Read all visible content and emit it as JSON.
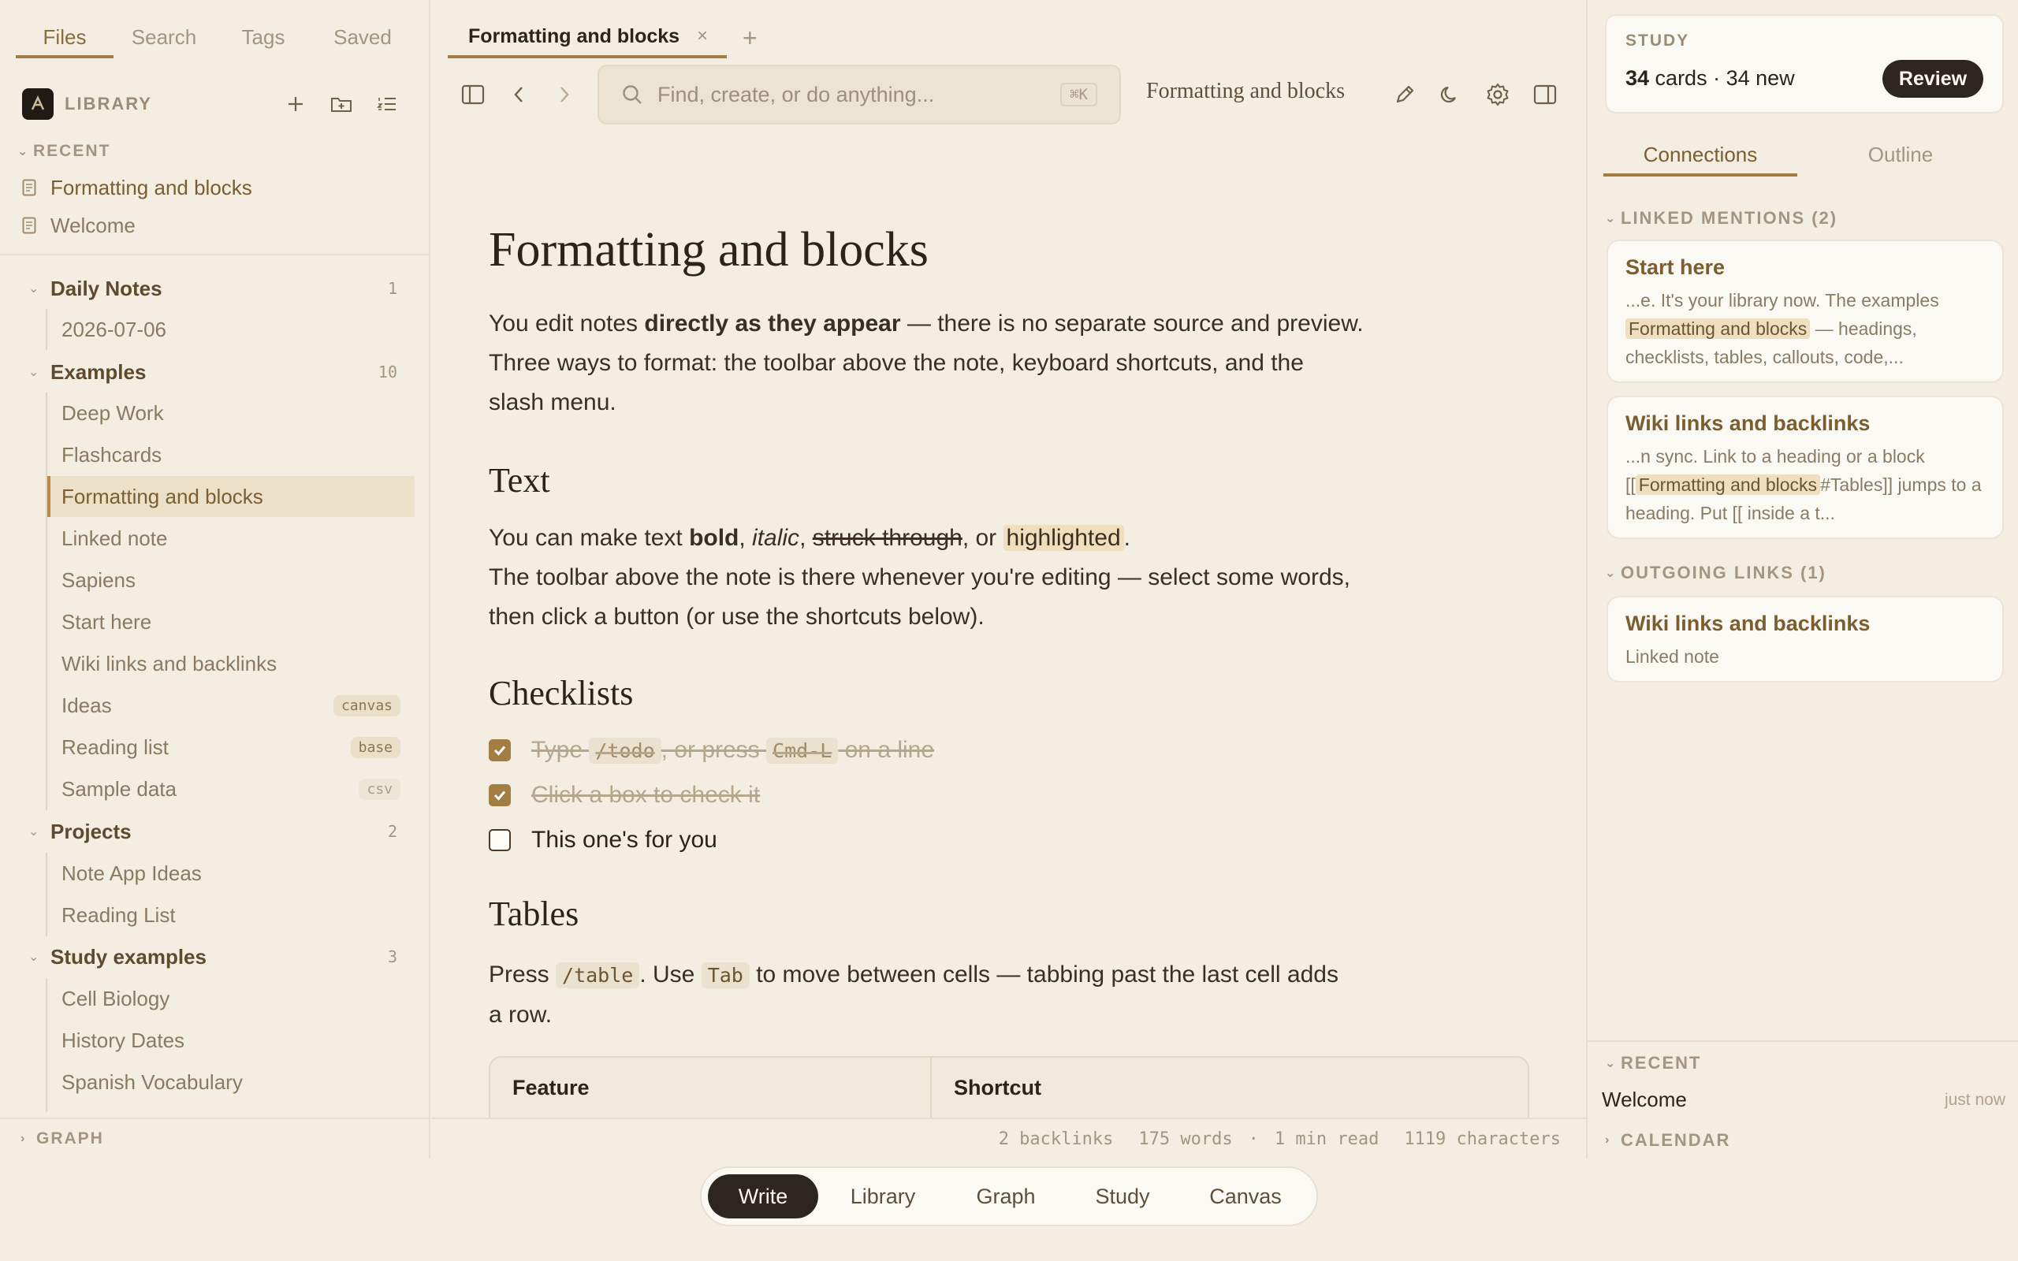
{
  "left_tabs": [
    {
      "label": "Files",
      "active": true
    },
    {
      "label": "Search",
      "active": false
    },
    {
      "label": "Tags",
      "active": false
    },
    {
      "label": "Saved",
      "active": false
    }
  ],
  "library": {
    "title": "LIBRARY"
  },
  "recent": {
    "title": "RECENT",
    "items": [
      "Formatting and blocks",
      "Welcome"
    ]
  },
  "tree": {
    "daily_notes": {
      "name": "Daily Notes",
      "count": "1",
      "children": [
        "2026-07-06"
      ]
    },
    "examples": {
      "name": "Examples",
      "count": "10",
      "children": [
        {
          "name": "Deep Work",
          "badge": ""
        },
        {
          "name": "Flashcards",
          "badge": ""
        },
        {
          "name": "Formatting and blocks",
          "badge": ""
        },
        {
          "name": "Linked note",
          "badge": ""
        },
        {
          "name": "Sapiens",
          "badge": ""
        },
        {
          "name": "Start here",
          "badge": ""
        },
        {
          "name": "Wiki links and backlinks",
          "badge": ""
        },
        {
          "name": "Ideas",
          "badge": "canvas"
        },
        {
          "name": "Reading list",
          "badge": "base"
        },
        {
          "name": "Sample data",
          "badge": "csv"
        }
      ]
    },
    "projects": {
      "name": "Projects",
      "count": "2",
      "children": [
        "Note App Ideas",
        "Reading List"
      ]
    },
    "study": {
      "name": "Study examples",
      "count": "3",
      "children": [
        "Cell Biology",
        "History Dates",
        "Spanish Vocabulary"
      ]
    }
  },
  "graph_footer": "GRAPH",
  "doc_tab": {
    "label": "Formatting and blocks",
    "close": "×",
    "new": "+"
  },
  "search": {
    "placeholder": "Find, create, or do anything...",
    "shortcut": "⌘K"
  },
  "toolbar_title": "Formatting and blocks",
  "note": {
    "title": "Formatting and blocks",
    "intro": {
      "a": "You edit notes ",
      "b": "directly as they appear",
      "c": " — there is no separate source and preview. Three ways to format: the toolbar above the note, keyboard shortcuts, and the slash menu."
    },
    "text_heading": "Text",
    "text_line1": {
      "a": "You can make text ",
      "bold": "bold",
      "c": ", ",
      "italic": "italic",
      "d": ", ",
      "strike": "struck through",
      "e": ", or ",
      "hl": "highlighted",
      "f": "."
    },
    "text_line2": "The toolbar above the note is there whenever you're editing — select some words, then click a button (or use the shortcuts below).",
    "checklists_heading": "Checklists",
    "check1": {
      "a": "Type ",
      "code1": "/todo",
      "b": ", or press ",
      "code2": "Cmd-L",
      "c": " on a line"
    },
    "check2": "Click a box to check it",
    "check3": "This one's for you",
    "tables_heading": "Tables",
    "tables_para": {
      "a": "Press ",
      "code1": "/table",
      "b": ". Use ",
      "code2": "Tab",
      "c": " to move between cells — tabbing past the last cell adds a row."
    },
    "table_headers": [
      "Feature",
      "Shortcut"
    ]
  },
  "status": {
    "backlinks": "2 backlinks",
    "words": "175 words",
    "dot": "·",
    "read": "1 min read",
    "chars": "1119 characters"
  },
  "study_card": {
    "label": "STUDY",
    "count_bold": "34",
    "count_rest": " cards · 34 new",
    "button": "Review"
  },
  "right_tabs": [
    {
      "label": "Connections",
      "active": true
    },
    {
      "label": "Outline",
      "active": false
    }
  ],
  "linked_mentions": {
    "title": "LINKED MENTIONS (2)",
    "items": [
      {
        "title": "Start here",
        "pre": "...e. It's your library now. The examples ",
        "mark": "Formatting and blocks",
        "post": " — headings, checklists, tables, callouts, code,..."
      },
      {
        "title": "Wiki links and backlinks",
        "pre": "...n sync. Link to a heading or a block [[",
        "mark": "Formatting and blocks",
        "post": "#Tables]] jumps to a heading. Put [[ inside a t..."
      }
    ]
  },
  "outgoing_links": {
    "title": "OUTGOING LINKS (1)",
    "items": [
      {
        "title": "Wiki links and backlinks",
        "sub": "Linked note"
      }
    ]
  },
  "right_recent": {
    "title": "RECENT",
    "item": "Welcome",
    "time": "just now"
  },
  "calendar": {
    "title": "CALENDAR"
  },
  "bottom_nav": [
    {
      "label": "Write",
      "active": true
    },
    {
      "label": "Library",
      "active": false
    },
    {
      "label": "Graph",
      "active": false
    },
    {
      "label": "Study",
      "active": false
    },
    {
      "label": "Canvas",
      "active": false
    }
  ],
  "colors": {
    "accent": "#a47d45",
    "background": "#f3ede2",
    "dark": "#2d2620"
  }
}
